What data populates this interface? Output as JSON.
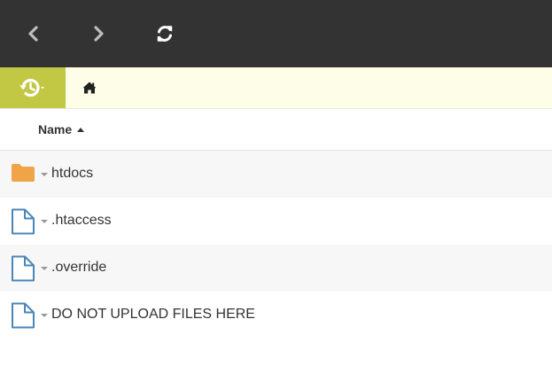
{
  "toolbar": {
    "back_icon": "chevron-left-icon",
    "forward_icon": "chevron-right-icon",
    "refresh_icon": "refresh-icon",
    "background": "#333333"
  },
  "pathbar": {
    "history_icon": "history-icon",
    "home_icon": "home-icon",
    "accent": "#c2c744"
  },
  "list_header": {
    "name_label": "Name",
    "sort": "ascending"
  },
  "files": [
    {
      "name": "htdocs",
      "type": "folder",
      "icon": "folder-icon"
    },
    {
      "name": ".htaccess",
      "type": "file",
      "icon": "file-icon"
    },
    {
      "name": ".override",
      "type": "file",
      "icon": "file-icon"
    },
    {
      "name": "DO NOT UPLOAD FILES HERE",
      "type": "file",
      "icon": "file-icon"
    }
  ]
}
